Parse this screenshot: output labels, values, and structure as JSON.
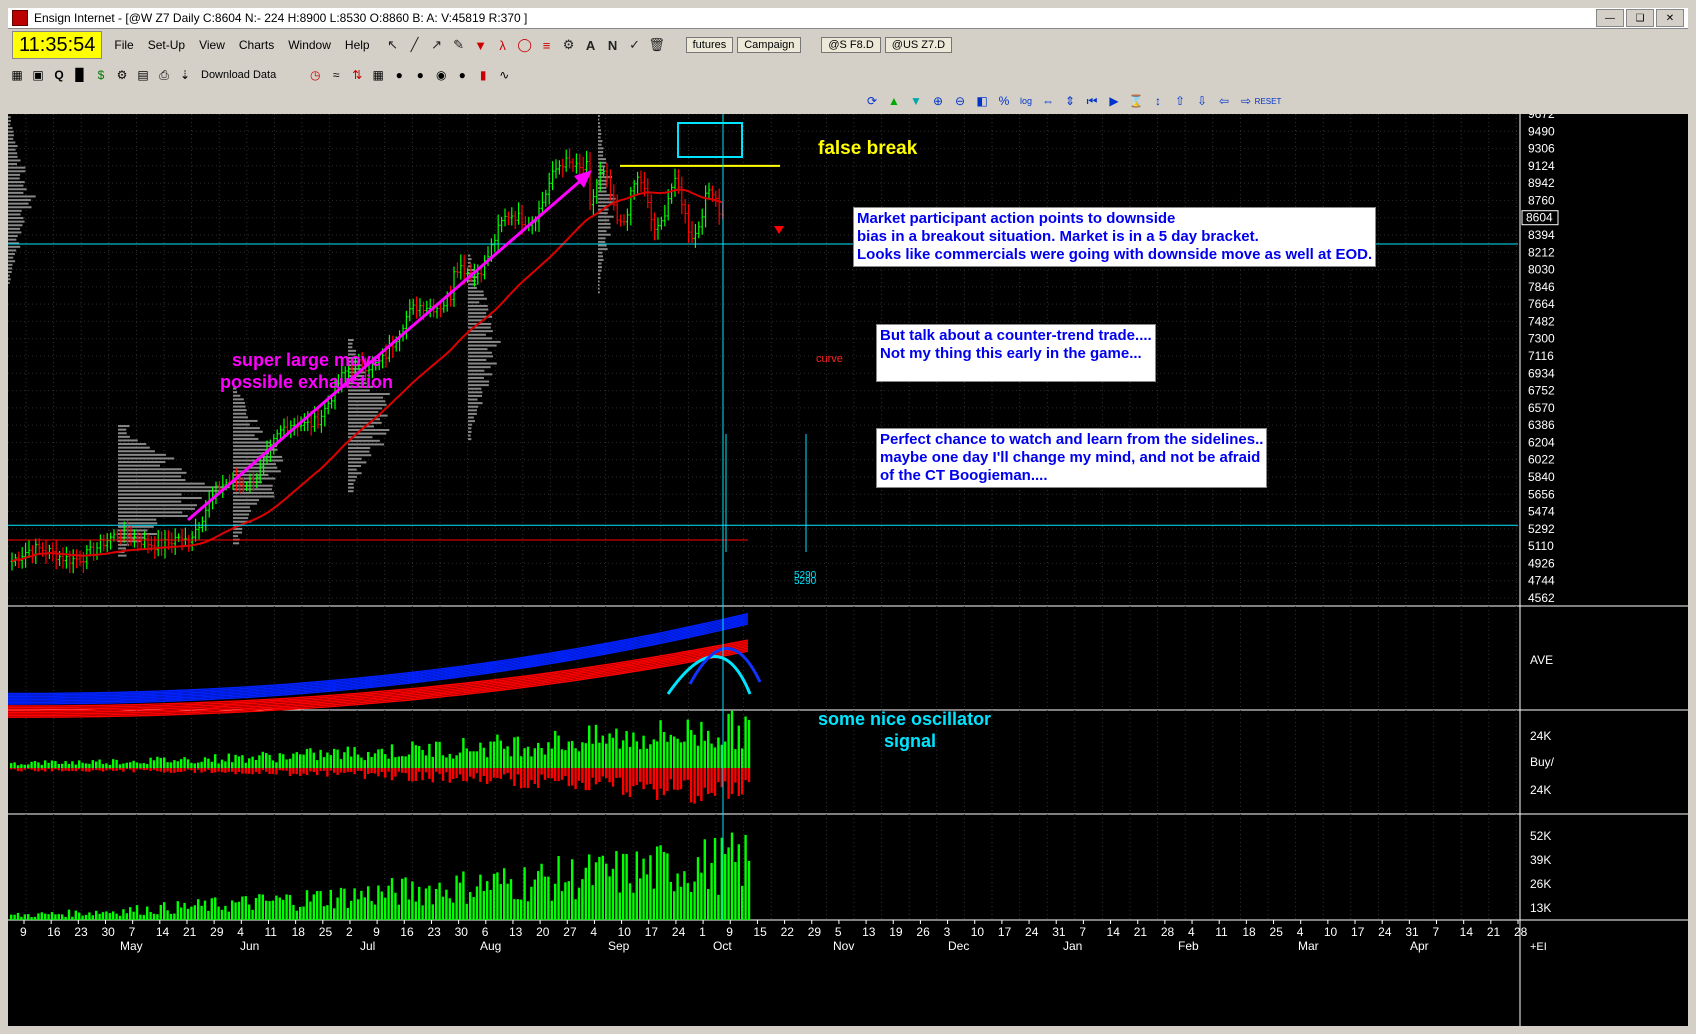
{
  "window": {
    "title": "Ensign Internet - [@W Z7 Daily C:8604 N:- 224 H:8900 L:8530 O:8860 B: A: V:45819 R:370 ]"
  },
  "clock": "11:35:54",
  "menu": [
    "File",
    "Set-Up",
    "View",
    "Charts",
    "Window",
    "Help"
  ],
  "tabs": [
    "futures",
    "Campaign",
    "@S F8.D",
    "@US Z7.D"
  ],
  "toolbar2": {
    "download_label": "Download Data"
  },
  "price_axis": [
    "9672",
    "9490",
    "9306",
    "9124",
    "8942",
    "8760",
    "8604",
    "8394",
    "8212",
    "8030",
    "7846",
    "7664",
    "7482",
    "7300",
    "7116",
    "6934",
    "6752",
    "6570",
    "6386",
    "6204",
    "6022",
    "5840",
    "5656",
    "5474",
    "5292",
    "5110",
    "4926",
    "4744",
    "4562"
  ],
  "current_price": "8604",
  "osc_axis": "AVE",
  "buysell_axis": [
    "24K",
    "Buy/",
    "24K"
  ],
  "volume_axis": [
    "52K",
    "39K",
    "26K",
    "13K"
  ],
  "date_ticks": [
    "9",
    "16",
    "23",
    "30",
    "7",
    "14",
    "21",
    "29",
    "4",
    "11",
    "18",
    "25",
    "2",
    "9",
    "16",
    "23",
    "30",
    "6",
    "13",
    "20",
    "27",
    "4",
    "10",
    "17",
    "24",
    "1",
    "9",
    "15",
    "22",
    "29",
    "5",
    "13",
    "19",
    "26",
    "3",
    "10",
    "17",
    "24",
    "31",
    "7",
    "14",
    "21",
    "28",
    "4",
    "11",
    "18",
    "25",
    "4",
    "10",
    "17",
    "24",
    "31",
    "7",
    "14",
    "21",
    "28"
  ],
  "month_labels": [
    "May",
    "Jun",
    "Jul",
    "Aug",
    "Sep",
    "Oct",
    "Nov",
    "Dec",
    "Jan",
    "Feb",
    "Mar",
    "Apr"
  ],
  "corner_label": "+EI",
  "annotations": {
    "false_break": "false break",
    "big_move_1": "super large move",
    "big_move_2": "possible exhaustion",
    "osc_1": "some nice oscillator",
    "osc_2": "signal",
    "curve": "curve",
    "level_a": "5290",
    "level_b": "5290",
    "box1": [
      "Market participant action points to downside",
      "bias in a breakout situation. Market is in a 5 day bracket.",
      "Looks like commercials were going with downside move as well at EOD."
    ],
    "box2": [
      "But talk about a counter-trend trade....",
      "Not my thing this early in the game..."
    ],
    "box3": [
      "Perfect chance to watch and learn from the sidelines..",
      "maybe one day I'll change my mind, and not be afraid",
      "of the CT Boogieman...."
    ]
  },
  "colors": {
    "chart_bg": "#000000",
    "up": "#00ff00",
    "down": "#ff0000",
    "avg": "#dd0000",
    "cyan": "#00e5ff",
    "magenta": "#ff00ff",
    "yellow": "#ffff00"
  }
}
